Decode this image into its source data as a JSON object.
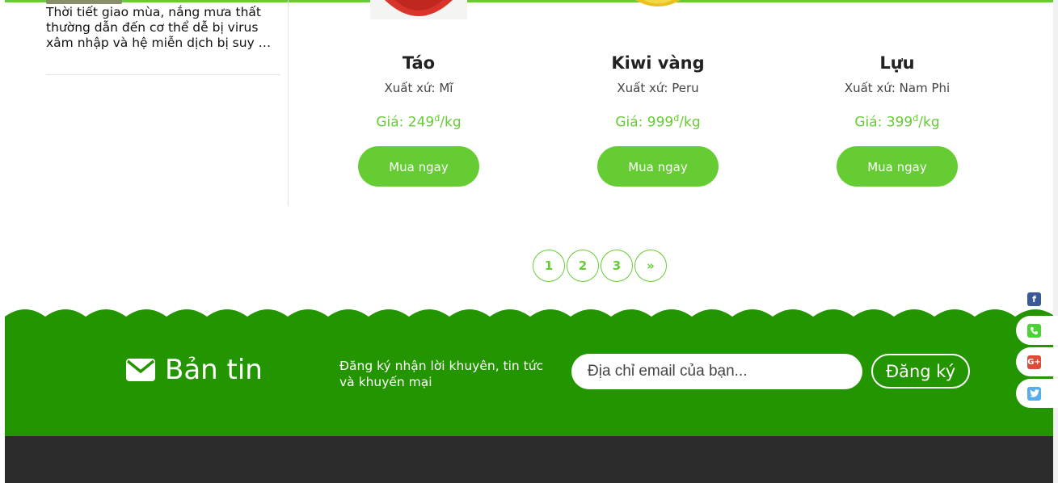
{
  "sidebar": {
    "news_excerpt": "Thời tiết giao mùa, nắng mưa thất thường dẫn đến cơ thể dễ bị virus xâm nhập và hệ miễn dịch bị suy …"
  },
  "products": [
    {
      "name": "Táo",
      "origin": "Xuất xứ: Mĩ",
      "price_prefix": "Giá: 249",
      "currency": "đ",
      "unit": "/kg",
      "buy_label": "Mua ngay"
    },
    {
      "name": "Kiwi vàng",
      "origin": "Xuất xứ: Peru",
      "price_prefix": "Giá: 999",
      "currency": "đ",
      "unit": "/kg",
      "buy_label": "Mua ngay"
    },
    {
      "name": "Lựu",
      "origin": "Xuất xứ: Nam Phi",
      "price_prefix": "Giá: 399",
      "currency": "đ",
      "unit": "/kg",
      "buy_label": "Mua ngay"
    }
  ],
  "pagination": {
    "pages": [
      "1",
      "2",
      "3"
    ],
    "next": "»"
  },
  "newsletter": {
    "title": "Bản tin",
    "description": "Đăng ký nhận lời khuyên, tin tức và khuyến mại",
    "email_placeholder": "Địa chỉ email của bạn...",
    "subscribe_label": "Đăng ký"
  },
  "social": [
    {
      "icon": "facebook-icon",
      "color": "#3b5998"
    },
    {
      "icon": "phone-icon",
      "color": "#4cd137"
    },
    {
      "icon": "google-plus-icon",
      "color": "#dd4b39"
    },
    {
      "icon": "twitter-icon",
      "color": "#55acee"
    }
  ],
  "colors": {
    "accent": "#66cc33",
    "newsletter_bg": "#239500",
    "footer_bg": "#2c2c2c"
  }
}
